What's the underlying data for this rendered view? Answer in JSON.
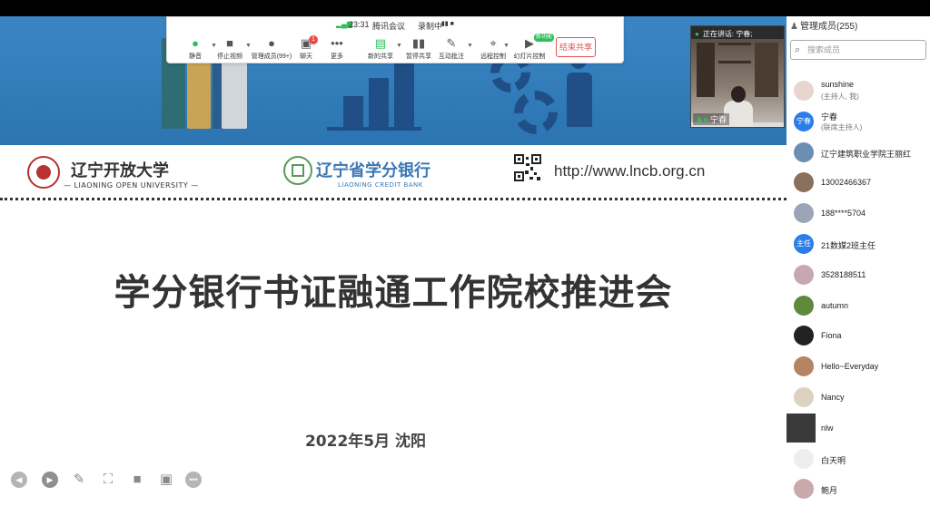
{
  "status_bar": {
    "time": "23:31",
    "app_name": "腾讯会议",
    "recording": "录制中",
    "recording_ctrl": "▮▮ ■"
  },
  "toolbar": {
    "mute": "静音",
    "stop_video": "停止视频",
    "manage_members": "管理成员(99+)",
    "chat": "聊天",
    "chat_badge": "1",
    "more": "更多",
    "new_share": "新的共享",
    "pause_share": "暂停共享",
    "annotate": "互动批注",
    "remote_control": "远程控制",
    "slide_control": "幻灯片控制",
    "slide_badge": "新功能",
    "end_share": "结束共享"
  },
  "video": {
    "speaking_prefix": "正在讲话:",
    "speaking_name": "宁春;",
    "name": "宁春"
  },
  "slide": {
    "logo1_cn": "辽宁开放大学",
    "logo1_en": "LIAONING OPEN UNIVERSITY",
    "logo2_cn": "辽宁省学分银行",
    "logo2_en": "LIAONING CREDIT BANK",
    "url": "http://www.lncb.org.cn",
    "title": "学分银行书证融通工作院校推进会",
    "date_place": "2022年5月  沈阳"
  },
  "panel": {
    "title": "管理成员(255)",
    "search_placeholder": "搜索成员",
    "members": [
      {
        "name": "sunshine",
        "role": "(主持人, 我)",
        "avatar": "",
        "color": "#e8d5cf"
      },
      {
        "name": "宁春",
        "role": "(联席主持人)",
        "avatar": "宁春",
        "color": "#2b7de9"
      },
      {
        "name": "辽宁建筑职业学院王丽红",
        "role": "",
        "avatar": "",
        "color": "#6b8fb3"
      },
      {
        "name": "13002466367",
        "role": "",
        "avatar": "",
        "color": "#8a6f5c"
      },
      {
        "name": "188****5704",
        "role": "",
        "avatar": "",
        "color": "#9aa5b8"
      },
      {
        "name": "21数媒2班主任",
        "role": "",
        "avatar": "主任",
        "color": "#2b7de9"
      },
      {
        "name": "3528188511",
        "role": "",
        "avatar": "",
        "color": "#c9a7b0"
      },
      {
        "name": "autumn",
        "role": "",
        "avatar": "",
        "color": "#5f8a3c"
      },
      {
        "name": "Fiona",
        "role": "",
        "avatar": "",
        "color": "#222222"
      },
      {
        "name": "Hello~Everyday",
        "role": "",
        "avatar": "",
        "color": "#b58462"
      },
      {
        "name": "Nancy",
        "role": "",
        "avatar": "",
        "color": "#ddd2c2"
      },
      {
        "name": "nlw",
        "role": "",
        "avatar": "",
        "color": "#3a3a3a"
      },
      {
        "name": "白天明",
        "role": "",
        "avatar": "",
        "color": "#eeeeee"
      },
      {
        "name": "鲍月",
        "role": "",
        "avatar": "",
        "color": "#c9a9a9"
      }
    ]
  }
}
